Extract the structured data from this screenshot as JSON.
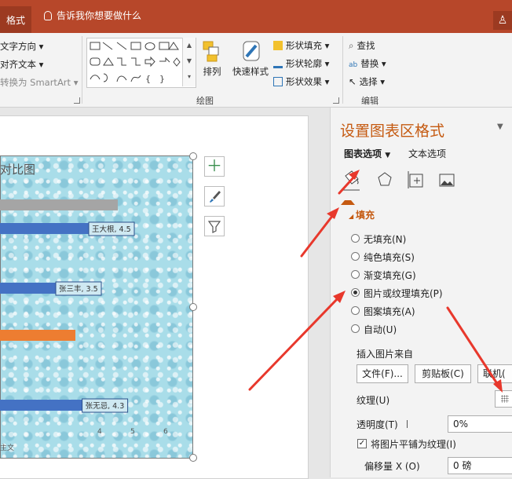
{
  "titlebar": {
    "active_tab": "格式",
    "tell_me": "告诉我你想要做什么"
  },
  "ribbon": {
    "text_direction": "文字方向",
    "align_text": "对齐文本",
    "convert_smartart": "转换为 SmartArt",
    "arrange": "排列",
    "quick_styles": "快速样式",
    "shape_fill": "形状填充",
    "shape_outline": "形状轮廓",
    "shape_effects": "形状效果",
    "find": "查找",
    "replace": "替换",
    "select": "选择",
    "group_drawing": "绘图",
    "group_editing": "编辑"
  },
  "chart": {
    "title_fragment": "对比图",
    "footer_fragment": "主文",
    "bar_colors": {
      "gray": "#a5a5a5",
      "blue": "#4472c4",
      "orange": "#ed7d31"
    },
    "chart_data": {
      "type": "bar",
      "title": "对比图",
      "categories": [
        "王大根",
        "张三丰",
        "张无忌"
      ],
      "values": [
        4.5,
        3.5,
        4.3
      ],
      "data_labels": [
        "王大根, 4.5",
        "张三丰, 3.5",
        "张无忌, 4.3"
      ],
      "x_ticks": [
        "4",
        "5",
        "6"
      ],
      "xlim": [
        0,
        6
      ]
    }
  },
  "pane": {
    "title": "设置图表区格式",
    "tab_chart_options": "图表选项",
    "tab_text_options": "文本选项",
    "section_fill": "填充",
    "fill_options": [
      {
        "label": "无填充(N)",
        "selected": false
      },
      {
        "label": "纯色填充(S)",
        "selected": false
      },
      {
        "label": "渐变填充(G)",
        "selected": false
      },
      {
        "label": "图片或纹理填充(P)",
        "selected": true
      },
      {
        "label": "图案填充(A)",
        "selected": false
      },
      {
        "label": "自动(U)",
        "selected": false
      }
    ],
    "insert_from": "插入图片来自",
    "btn_file": "文件(F)...",
    "btn_clipboard": "剪贴板(C)",
    "btn_online": "联机(",
    "texture_label": "纹理(U)",
    "transparency_label": "透明度(T)",
    "transparency_value": "0%",
    "tile_checkbox": "将图片平铺为纹理(I)",
    "offset_x_label": "偏移量 X (O)",
    "offset_x_value": "0 磅"
  },
  "accent": "#c55a11",
  "arrow_color": "#e8382c"
}
